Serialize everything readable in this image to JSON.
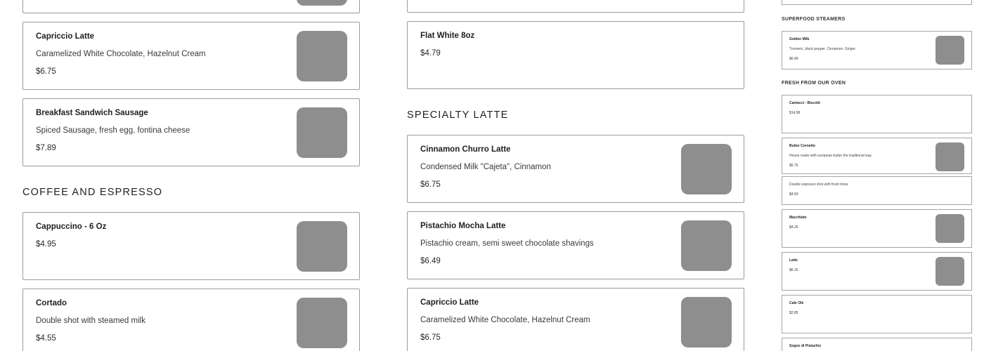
{
  "left_column": {
    "capriccio": {
      "name": "Capriccio Latte",
      "desc": "Caramelized White Chocolate, Hazelnut Cream",
      "price": "$6.75"
    },
    "breakfast": {
      "name": "Breakfast Sandwich Sausage",
      "desc": "Spiced Sausage, fresh egg, fontina cheese",
      "price": "$7.89"
    },
    "coffee_section_title": "Coffee and Espresso",
    "cappuccino": {
      "name": "Cappuccino - 6 Oz",
      "price": "$4.95"
    },
    "cortado": {
      "name": "Cortado",
      "desc": "Double shot with steamed milk",
      "price": "$4.55"
    }
  },
  "middle_column": {
    "flat_white": {
      "name": "Flat White 8oz",
      "price": "$4.79"
    },
    "specialty_section_title": "Specialty Latte",
    "churro": {
      "name": "Cinnamon Churro Latte",
      "desc": "Condensed Milk \"Cajeta\", Cinnamon",
      "price": "$6.75"
    },
    "pistachio": {
      "name": "Pistachio Mocha Latte",
      "desc": "Pistachio cream, semi sweet chocolate shavings",
      "price": "$6.49"
    },
    "capriccio": {
      "name": "Capriccio Latte",
      "desc": "Caramelized White Chocolate, Hazelnut Cream",
      "price": "$6.75"
    }
  },
  "right_column": {
    "superfood_title": "Superfood Steamers",
    "golden_milk": {
      "name": "Golden Milk",
      "desc": "Turmeric, black pepper, Cinnamon, Ginger",
      "price": "$6.49"
    },
    "oven_title": "Fresh from our oven",
    "cantucci": {
      "name": "Cantucci - Biscotti",
      "price": "$14.99"
    },
    "cornetto": {
      "name": "Butter Cornetto",
      "desc": "House made with european butter the traditional way",
      "price": "$5.75"
    },
    "double_espresso": {
      "desc": "Double espresso shot with fresh brew",
      "price": "$4.50"
    },
    "macchiato": {
      "name": "Macchiato",
      "price": "$4.25"
    },
    "latte": {
      "name": "Latte",
      "price": "$6.15"
    },
    "cafe_ole": {
      "name": "Cafe Olé",
      "price": "$2.85"
    },
    "sogno": {
      "name": "Sogno di Pistachio"
    }
  },
  "colors": {
    "card_border": "#9b9b9b",
    "image_placeholder": "#8e8e8e"
  }
}
